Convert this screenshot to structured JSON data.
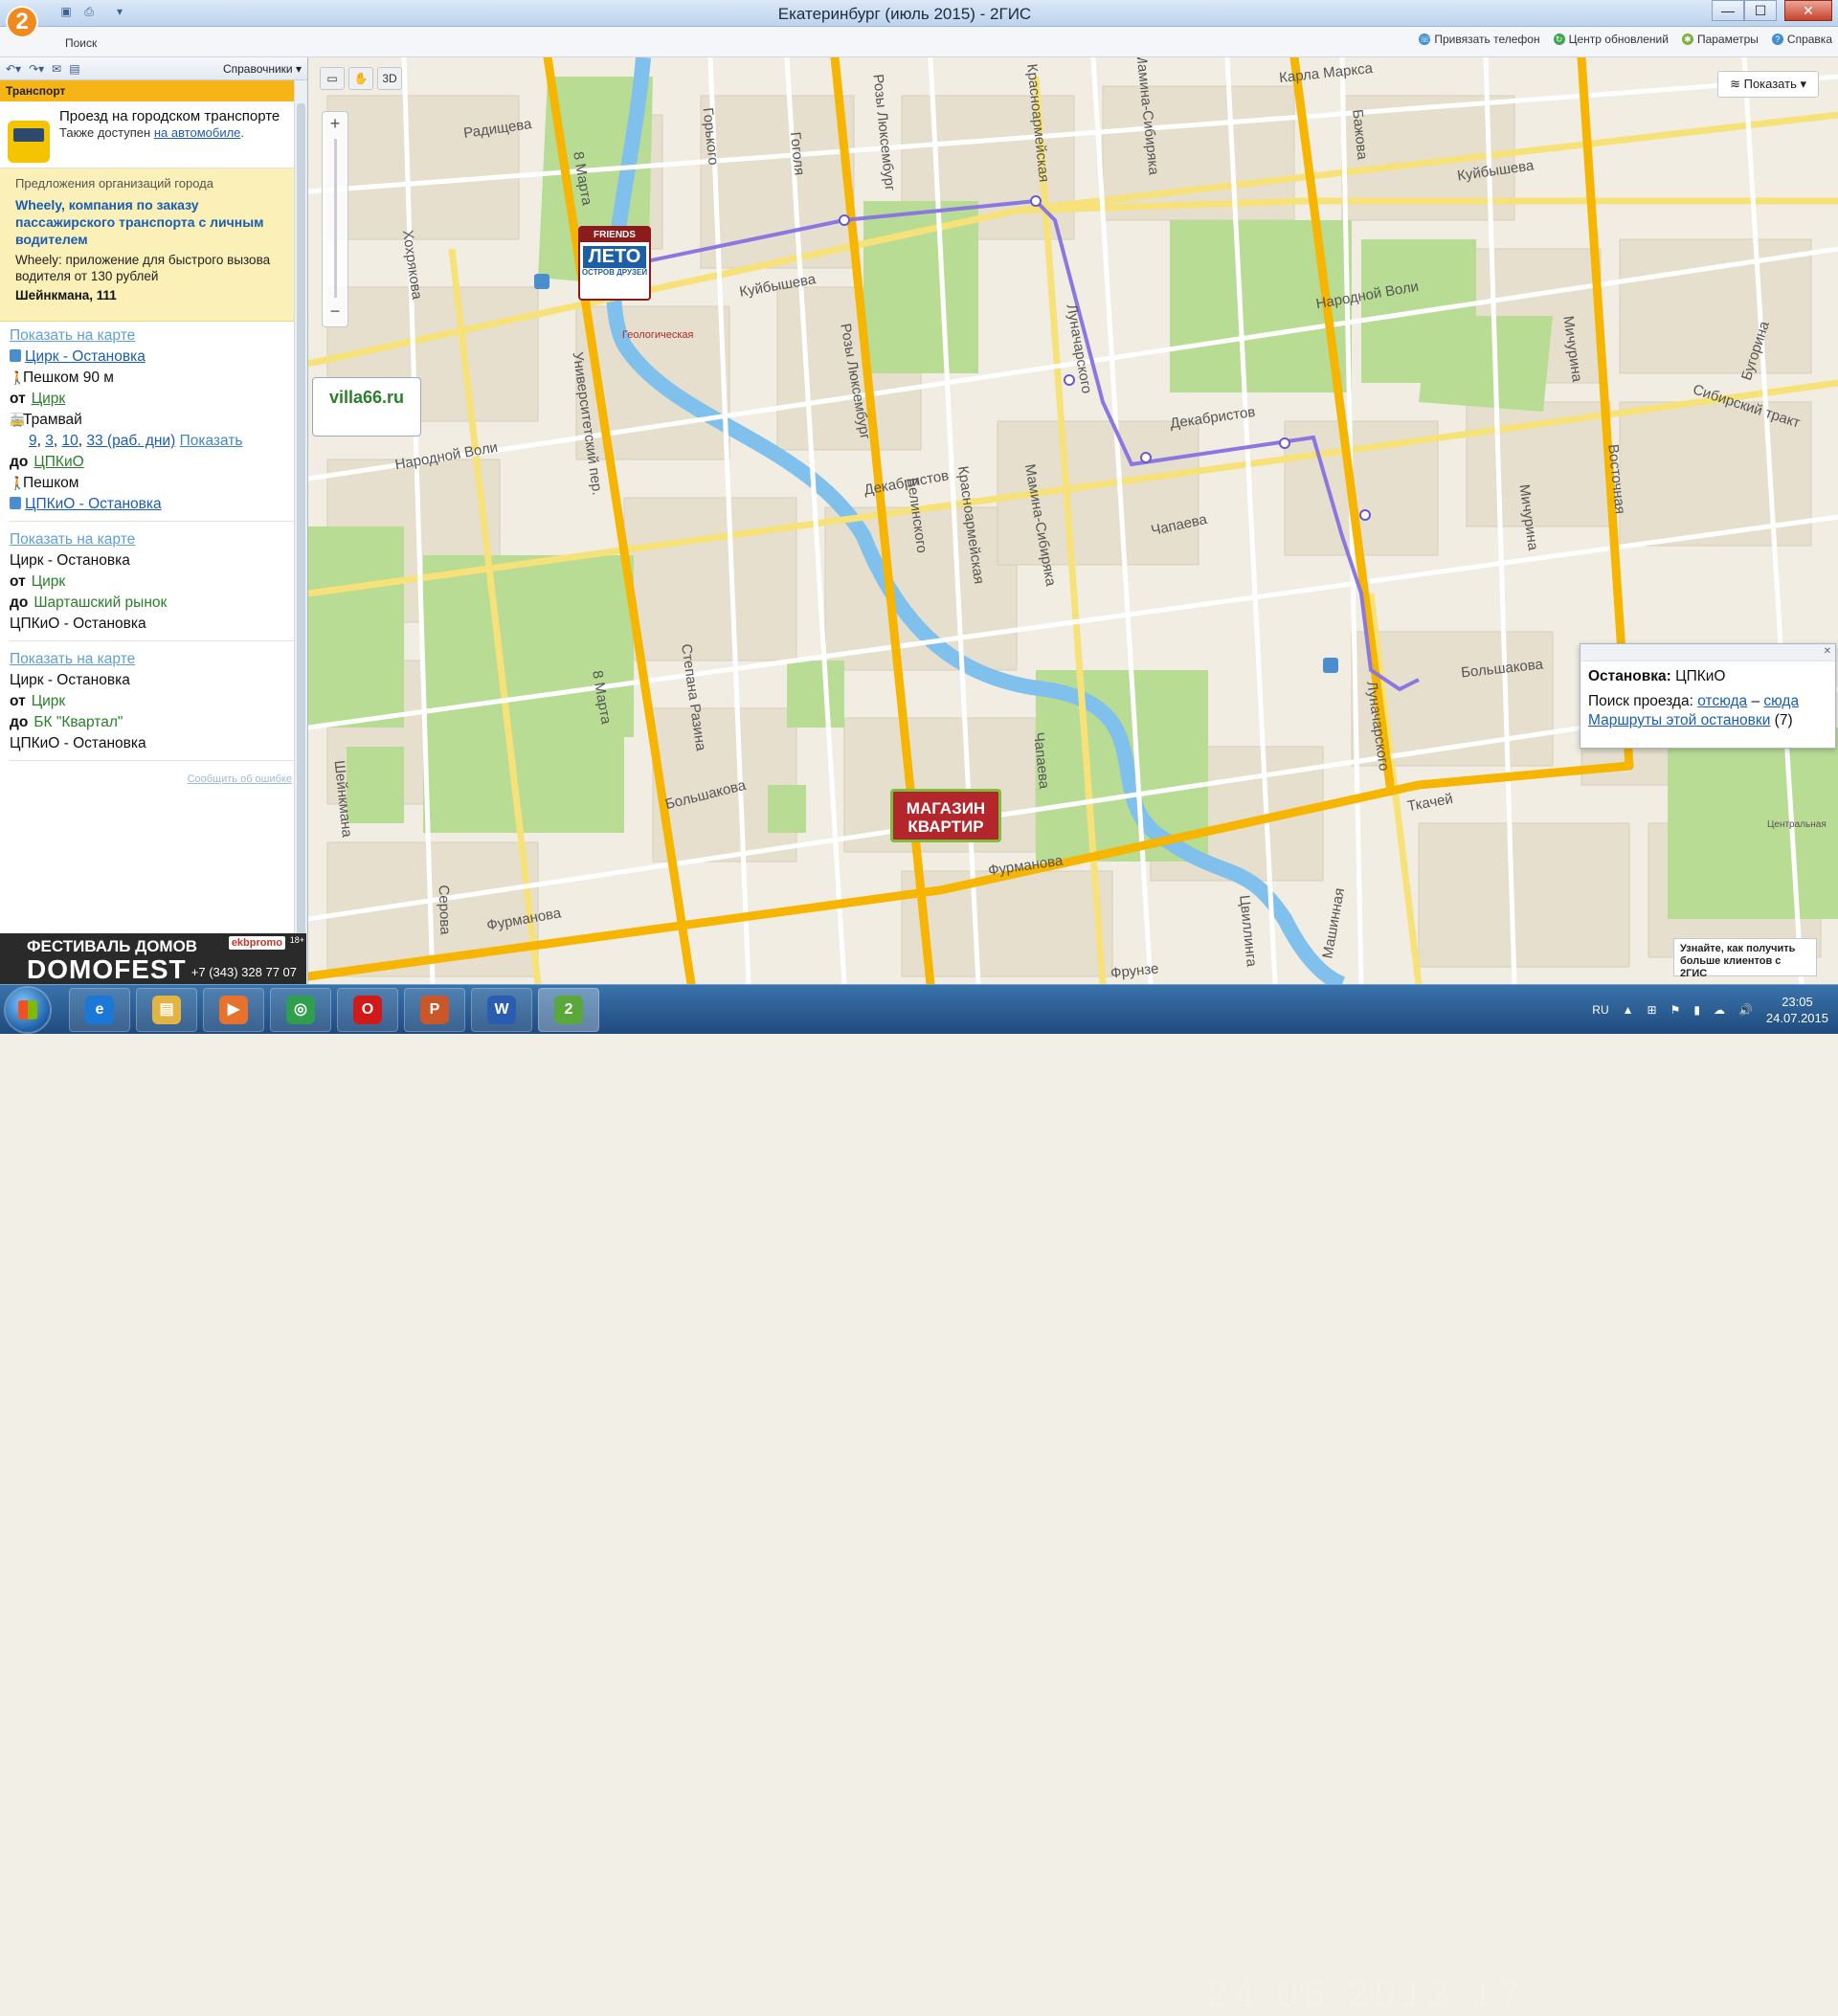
{
  "window": {
    "title": "Екатеринбург (июль 2015) - 2ГИС",
    "logo": "2",
    "minimize": "—",
    "maximize": "☐",
    "close": "✕"
  },
  "toolbar": {
    "search_tab": "Поиск",
    "links": [
      {
        "label": "Привязать телефон",
        "icon": "phone-icon"
      },
      {
        "label": "Центр обновлений",
        "icon": "refresh-icon"
      },
      {
        "label": "Параметры",
        "icon": "gear-icon"
      },
      {
        "label": "Справка",
        "icon": "help-icon"
      }
    ]
  },
  "sidebar": {
    "reference_menu": "Справочники",
    "section_title": "Транспорт",
    "transport": {
      "title": "Проезд на городском транспорте",
      "also_text": "Также доступен",
      "car_link": "на автомобиле",
      "after": "."
    },
    "promo": {
      "caption": "Предложения организаций города",
      "company": "Wheely, компания по заказу пассажирского транспорта с личным водителем",
      "description": "Wheely: приложение для быстрого вызова водителя от 130 рублей",
      "address": "Шейнкмана, 111"
    },
    "route1": {
      "show_map": "Показать на карте",
      "from_stop": "Цирк - Остановка",
      "walk1": "Пешком 90 м",
      "from_label": "от",
      "from_value": "Цирк",
      "mode": "Трамвай",
      "numbers": [
        "9",
        "3",
        "10",
        "33 (раб. дни)"
      ],
      "show": "Показать",
      "to_label": "до",
      "to_value": "ЦПКиО",
      "walk2": "Пешком",
      "to_stop": "ЦПКиО - Остановка"
    },
    "route2": {
      "show_map": "Показать на карте",
      "from_stop": "Цирк - Остановка",
      "from_label": "от",
      "from_value": "Цирк",
      "to_label": "до",
      "to_value": "Шарташский рынок",
      "to_stop": "ЦПКиО - Остановка"
    },
    "route3": {
      "show_map": "Показать на карте",
      "from_stop": "Цирк - Остановка",
      "from_label": "от",
      "from_value": "Цирк",
      "to_label": "до",
      "to_value": "БК \"Квартал\"",
      "to_stop": "ЦПКиО - Остановка"
    },
    "report_error": "Сообщить об ошибке",
    "banner": {
      "line1": "ФЕСТИВАЛЬ ДОМОВ",
      "line2": "DOMOFEST",
      "phone": "+7 (343) 328 77 07",
      "logo": "ekbpromo",
      "age": "18+"
    }
  },
  "map": {
    "toolbar_3d": "3D",
    "show_button": "Показать",
    "stop_label": "Геологическая",
    "streets": [
      "Карла Маркса",
      "Радищева",
      "8 Марта",
      "Горького",
      "Гоголя",
      "Розы Люксембург",
      "Красноармейская",
      "Мамина-Сибиряка",
      "Бажова",
      "Куйбышева",
      "Куйбышева",
      "Хохрякова",
      "Университетский пер.",
      "Народной Воли",
      "Народной Воли",
      "Луначарского",
      "Мичурина",
      "Бугорина",
      "Сибирский тракт",
      "Декабристов",
      "Декабристов",
      "Восточная",
      "Белинского",
      "Розы Люксембург",
      "Красноармейская",
      "Мамина-Сибиряка",
      "Мичурина",
      "Чапаева",
      "Степана Разина",
      "8 Марта",
      "Большакова",
      "Большакова",
      "Ткачей",
      "Луначарского",
      "Фурманова",
      "Фурманова",
      "Шейнкмана",
      "Серова",
      "Цвиллинга",
      "Машинная",
      "Фрунзе",
      "Центральная",
      "Чапаева"
    ],
    "ads": {
      "friends_top": "FRIENDS",
      "friends_main": "ЛЕТО",
      "friends_sub": "ОСТРОВ ДРУЗЕЙ",
      "villa": "villa66.ru",
      "kvartir_1": "МАГАЗИН",
      "kvartir_2": "КВАРТИР"
    },
    "popup": {
      "stop_label": "Остановка:",
      "stop_name": "ЦПКиО",
      "search_label": "Поиск проезда:",
      "from_here": "отсюда",
      "dash": "–",
      "to_here": "сюда",
      "routes_link": "Маршруты этой остановки",
      "routes_count": "(7)"
    },
    "hint": "Узнайте, как получить больше клиентов с 2ГИС",
    "colors": {
      "main_road": "#f5b500",
      "secondary_road": "#f7e27a",
      "route": "#8a78e0",
      "park": "#b9dc95",
      "river": "#7fc0ec",
      "building": "#e6dfce"
    }
  },
  "taskbar": {
    "apps": [
      {
        "name": "ie",
        "label": "e",
        "color": "#1b78d6"
      },
      {
        "name": "explorer",
        "label": "▤",
        "color": "#e2b442"
      },
      {
        "name": "media",
        "label": "▶",
        "color": "#e8722c"
      },
      {
        "name": "chrome",
        "label": "◎",
        "color": "#2f9f4d"
      },
      {
        "name": "opera",
        "label": "O",
        "color": "#d01a1a"
      },
      {
        "name": "presentation",
        "label": "P",
        "color": "#c9572a"
      },
      {
        "name": "word",
        "label": "W",
        "color": "#2a5db0"
      },
      {
        "name": "2gis",
        "label": "2",
        "color": "#5aa83c"
      }
    ],
    "lang": "RU",
    "time": "23:05",
    "date": "24.07.2015",
    "watermark": "24 06 2013 17"
  }
}
